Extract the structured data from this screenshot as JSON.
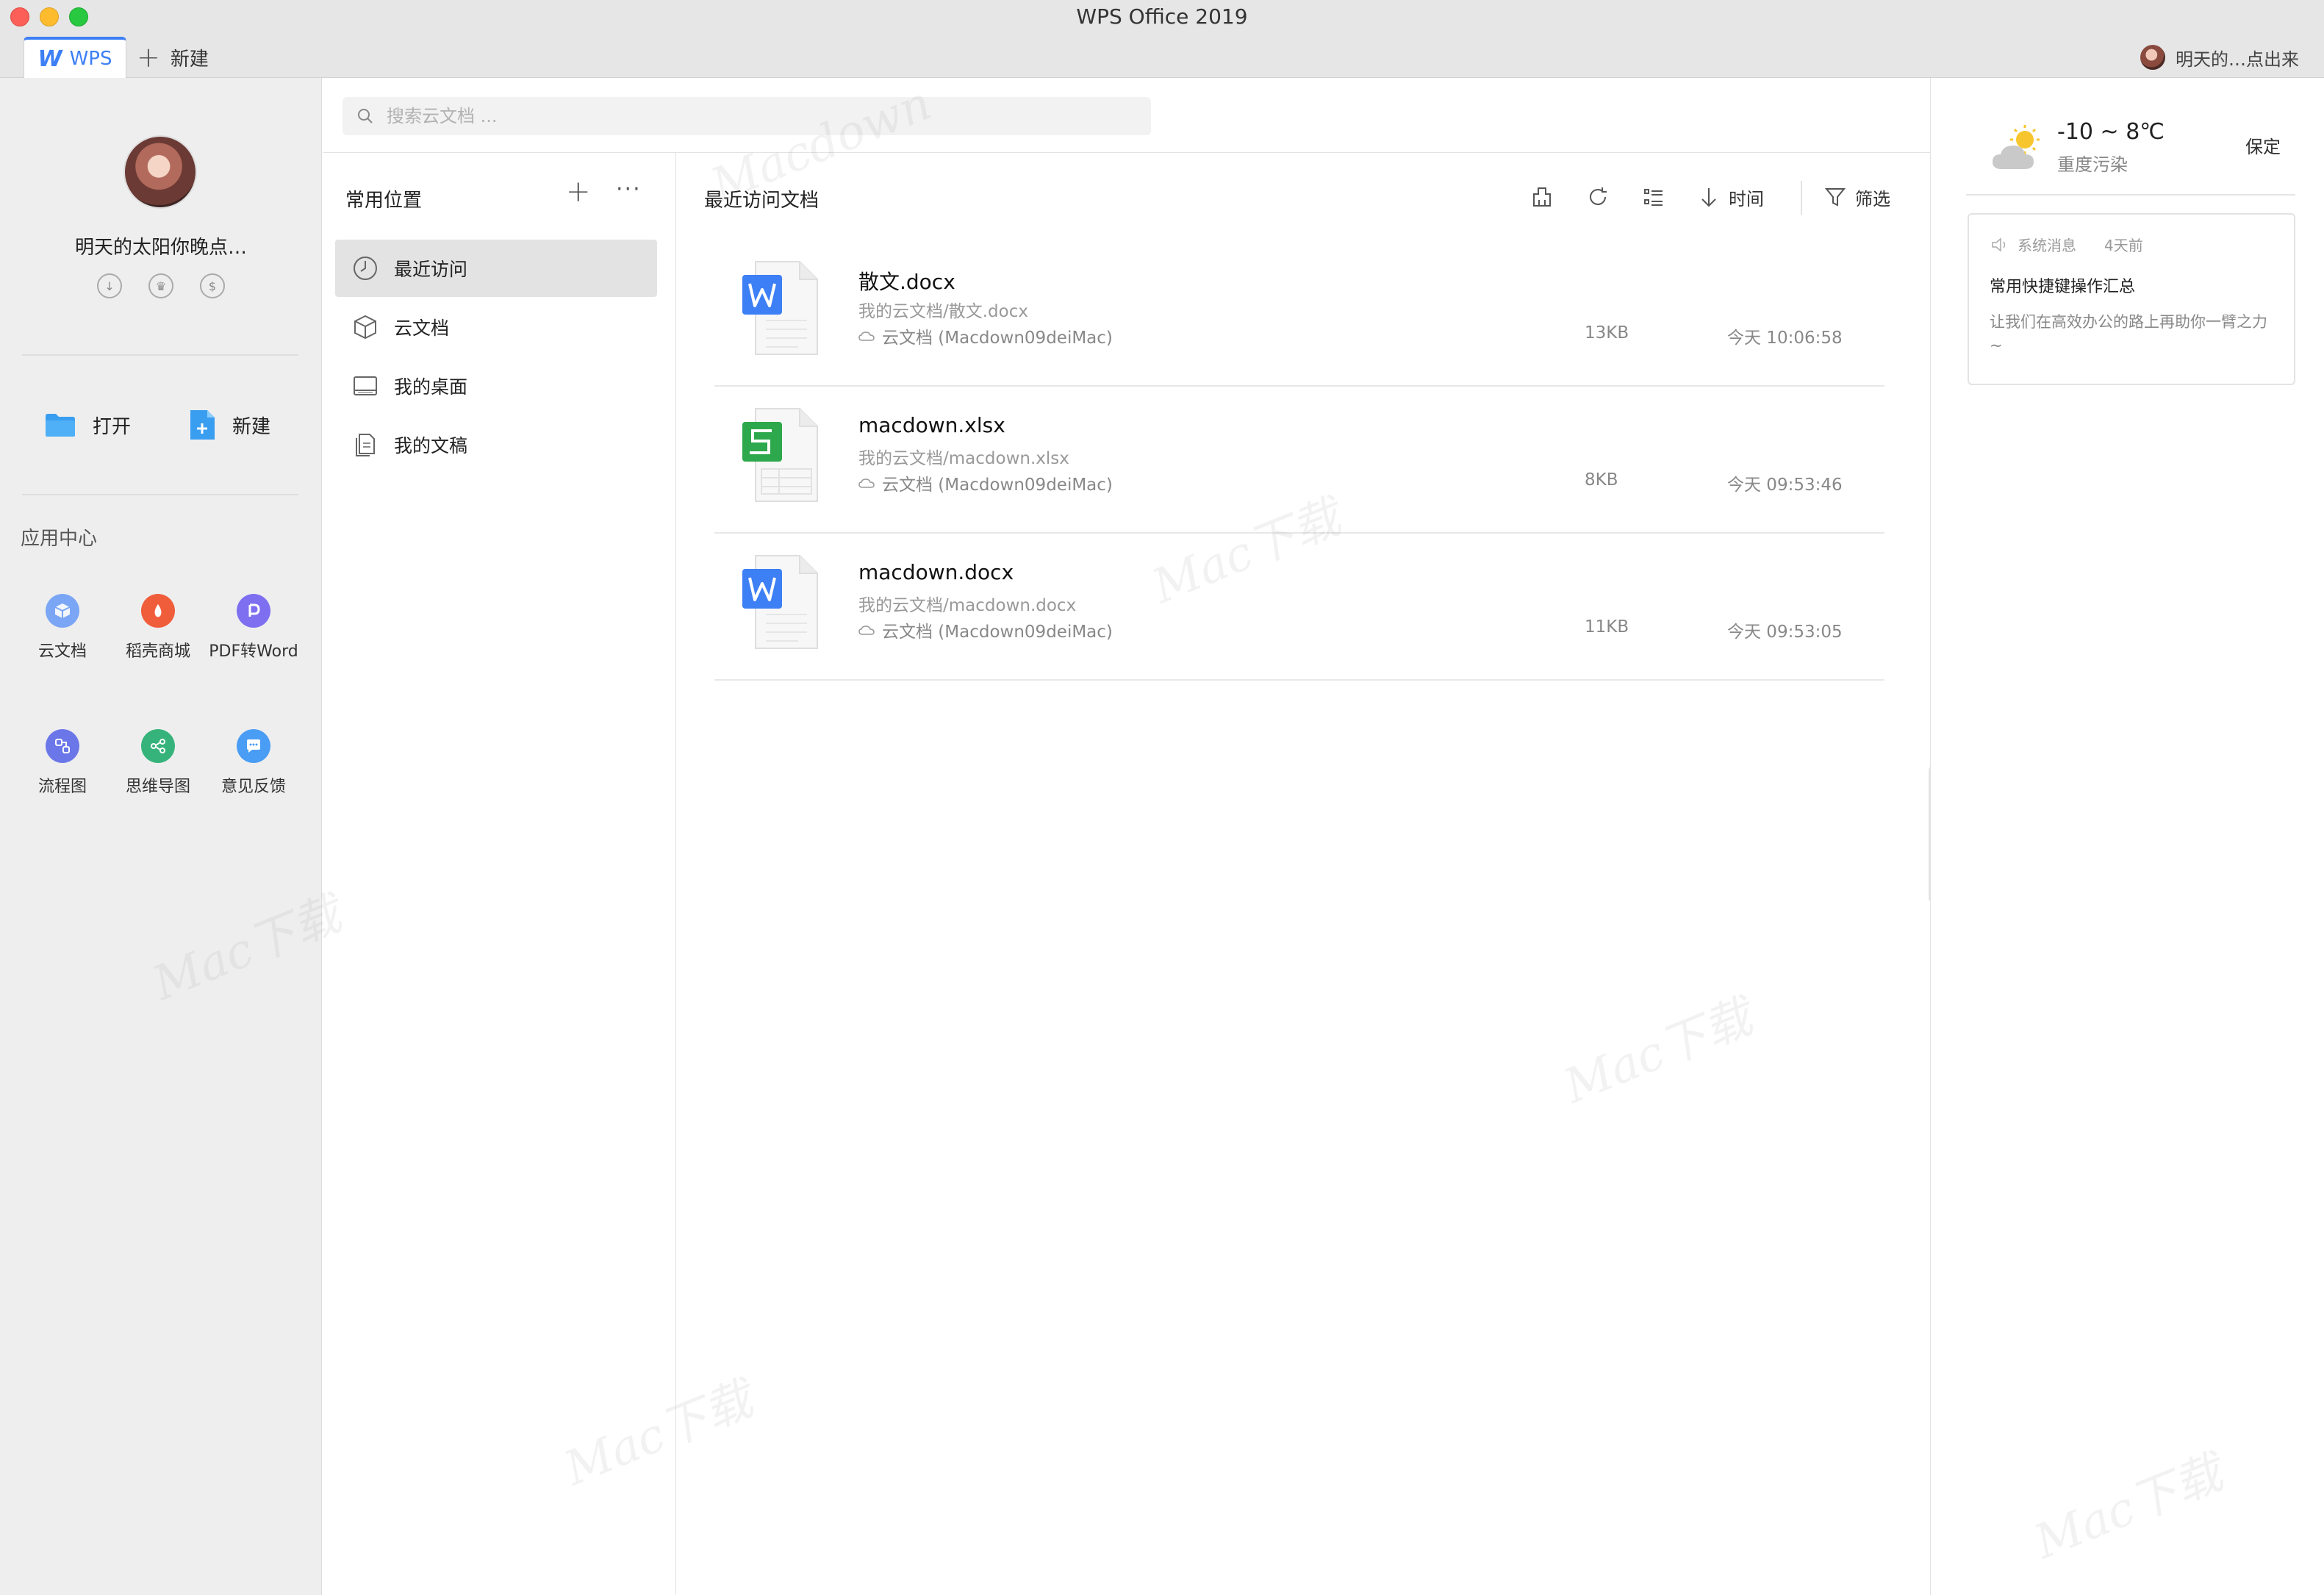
{
  "window": {
    "title": "WPS Office 2019"
  },
  "tabs": {
    "wps_label": "WPS",
    "new_label": "新建",
    "user_short": "明天的…点出来"
  },
  "sidebar": {
    "username": "明天的太阳你晚点…",
    "open_label": "打开",
    "new_label": "新建",
    "app_center_title": "应用中心",
    "apps": [
      {
        "label": "云文档",
        "icon": "cloud-doc-icon",
        "color": "#7aa6f5"
      },
      {
        "label": "稻壳商城",
        "icon": "docer-store-icon",
        "color": "#f05d3b"
      },
      {
        "label": "PDF转Word",
        "icon": "pdf-to-word-icon",
        "color": "#7d6ff0"
      },
      {
        "label": "流程图",
        "icon": "flowchart-icon",
        "color": "#6b77e8"
      },
      {
        "label": "思维导图",
        "icon": "mindmap-icon",
        "color": "#35b37a"
      },
      {
        "label": "意见反馈",
        "icon": "feedback-icon",
        "color": "#4a9df5"
      }
    ]
  },
  "search": {
    "placeholder": "搜索云文档 ..."
  },
  "nav": {
    "header": "常用位置",
    "items": [
      {
        "label": "最近访问",
        "icon": "clock-icon",
        "active": true
      },
      {
        "label": "云文档",
        "icon": "cube-icon",
        "active": false
      },
      {
        "label": "我的桌面",
        "icon": "desktop-icon",
        "active": false
      },
      {
        "label": "我的文稿",
        "icon": "documents-icon",
        "active": false
      }
    ]
  },
  "main": {
    "title": "最近访问文档",
    "sort_label": "时间",
    "filter_label": "筛选",
    "documents": [
      {
        "name": "散文.docx",
        "path": "我的云文档/散文.docx",
        "location": "云文档 (Macdown09deiMac)",
        "size": "13KB",
        "time": "今天 10:06:58",
        "type": "word"
      },
      {
        "name": "macdown.xlsx",
        "path": "我的云文档/macdown.xlsx",
        "location": "云文档 (Macdown09deiMac)",
        "size": "8KB",
        "time": "今天 09:53:46",
        "type": "sheet"
      },
      {
        "name": "macdown.docx",
        "path": "我的云文档/macdown.docx",
        "location": "云文档 (Macdown09deiMac)",
        "size": "11KB",
        "time": "今天 09:53:05",
        "type": "word"
      }
    ]
  },
  "weather": {
    "temp": "-10 ~ 8℃",
    "aqi": "重度污染",
    "city": "保定"
  },
  "message": {
    "category": "系统消息",
    "age": "4天前",
    "title": "常用快捷键操作汇总",
    "body": "让我们在高效办公的路上再助你一臂之力~"
  },
  "colors": {
    "accent": "#3d7ff5",
    "word": "#3d7ff5",
    "sheet": "#2ea84c"
  }
}
